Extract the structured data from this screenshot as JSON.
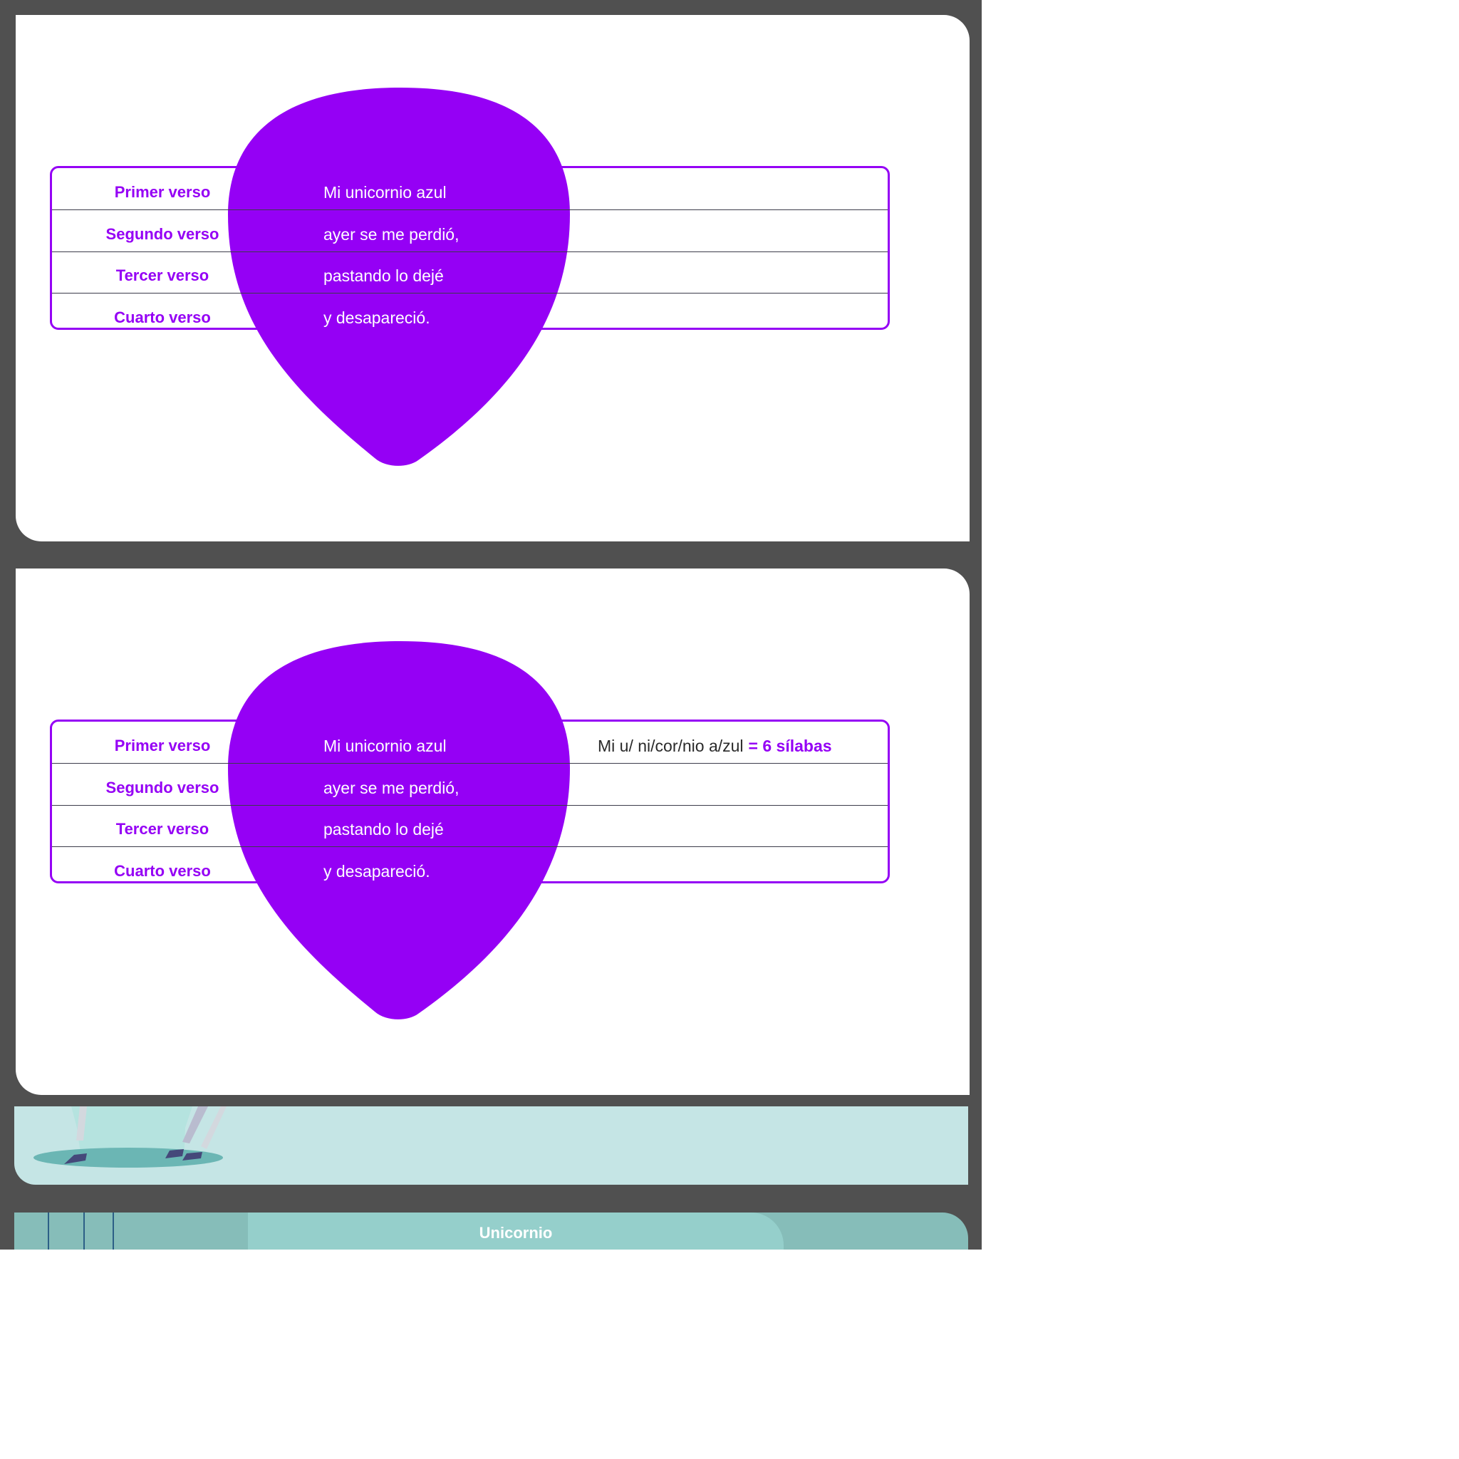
{
  "slides": [
    {
      "rows": [
        {
          "label": "Primer verso",
          "text": "Mi unicornio azul"
        },
        {
          "label": "Segundo verso",
          "text": "ayer se me perdió,"
        },
        {
          "label": "Tercer verso",
          "text": "pastando lo dejé"
        },
        {
          "label": "Cuarto verso",
          "text": "y desapareció."
        }
      ]
    },
    {
      "rows": [
        {
          "label": "Primer verso",
          "text": "Mi unicornio azul",
          "syllables": "Mi u/ ni/cor/nio a/zul",
          "result": "= 6 sílabas"
        },
        {
          "label": "Segundo verso",
          "text": "ayer se me perdió,"
        },
        {
          "label": "Tercer verso",
          "text": "pastando lo dejé"
        },
        {
          "label": "Cuarto verso",
          "text": "y desapareció."
        }
      ]
    }
  ],
  "thumbnail": {
    "title": "Unicornio"
  },
  "colors": {
    "accent": "#9500f5",
    "viewer_bg": "#505050",
    "teal": "#c5e5e5"
  }
}
